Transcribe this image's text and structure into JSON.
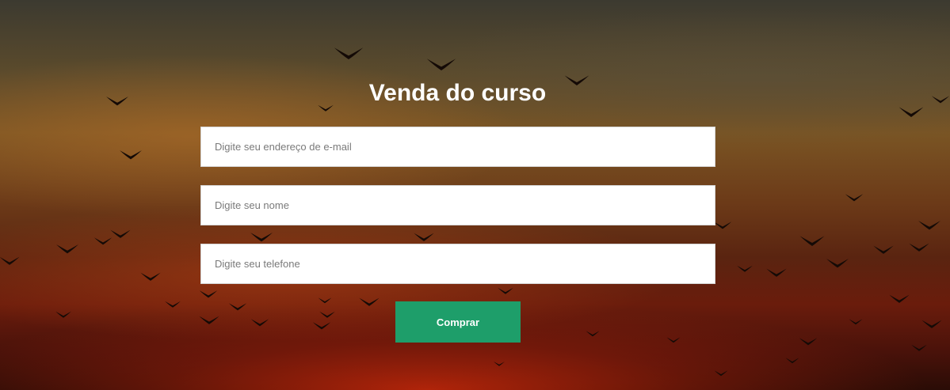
{
  "form": {
    "title": "Venda do curso",
    "email_placeholder": "Digite seu endereço de e-mail",
    "name_placeholder": "Digite seu nome",
    "phone_placeholder": "Digite seu telefone",
    "submit_label": "Comprar"
  },
  "colors": {
    "button": "#1e9e6a",
    "title": "#ffffff",
    "field_background": "#ffffff"
  },
  "background": {
    "icon": "sunset-birds-photo"
  }
}
